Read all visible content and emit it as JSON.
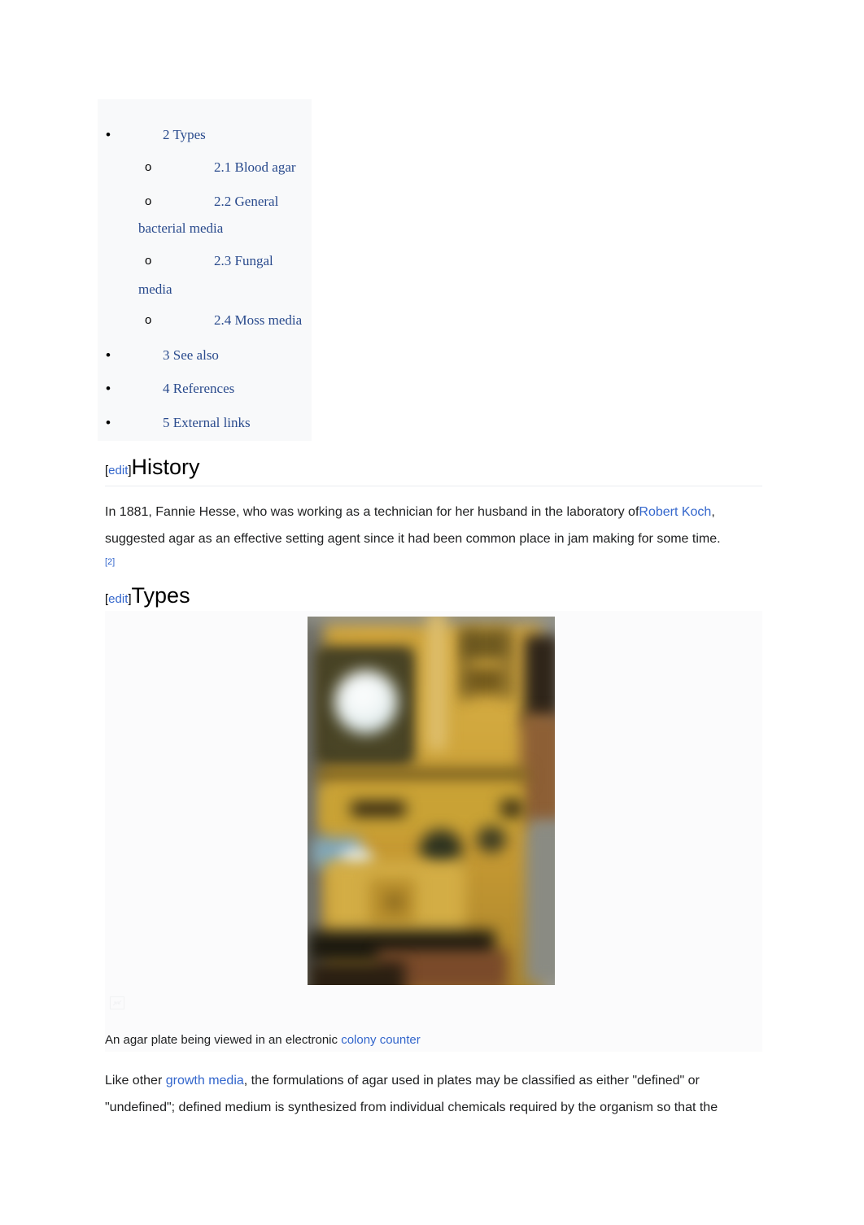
{
  "toc": {
    "items": [
      {
        "marker": "bullet",
        "number": "2",
        "label": "Types",
        "text": "2 Types",
        "level": 1
      },
      {
        "marker": "circle",
        "number": "2.1",
        "label": "Blood agar",
        "text": "2.1 Blood agar",
        "level": 2
      },
      {
        "marker": "circle",
        "number": "2.2",
        "label": "General bacterial media",
        "text": "2.2 General",
        "text2": "bacterial media",
        "level": 2
      },
      {
        "marker": "circle",
        "number": "2.3",
        "label": "Fungal media",
        "text": "2.3 Fungal",
        "text2": "media",
        "level": 2
      },
      {
        "marker": "circle",
        "number": "2.4",
        "label": "Moss media",
        "text": "2.4 Moss media",
        "level": 2
      },
      {
        "marker": "bullet",
        "number": "3",
        "label": "See also",
        "text": "3 See also",
        "level": 1
      },
      {
        "marker": "bullet",
        "number": "4",
        "label": "References",
        "text": "4 References",
        "level": 1
      },
      {
        "marker": "bullet",
        "number": "5",
        "label": "External links",
        "text": "5 External links",
        "level": 1
      }
    ],
    "bullet_glyph": "•",
    "circle_glyph": "o"
  },
  "sections": {
    "history": {
      "edit_open": "[",
      "edit_label": "edit",
      "edit_close": "]",
      "title": "History",
      "paragraph_line1_a": "In 1881, Fannie Hesse, who was working as a technician for her husband in the laboratory of",
      "paragraph_link": "Robert Koch",
      "paragraph_line1_b": ",",
      "paragraph_line2": "suggested agar as an effective setting agent since it had been common place in jam making for some time.",
      "reference": "[2]"
    },
    "types": {
      "edit_open": "[",
      "edit_label": "edit",
      "edit_close": "]",
      "title": "Types",
      "caption_a": "An agar plate being viewed in an electronic ",
      "caption_link": "colony counter",
      "paragraph_a": "Like other ",
      "paragraph_link": "growth media",
      "paragraph_b": ", the formulations of agar used in plates may be classified as either \"defined\" or \"undefined\"; defined medium is synthesized from individual chemicals required by the organism so that the"
    }
  },
  "colors": {
    "toc_link": "#2a4b8d",
    "body_link": "#3366cc",
    "text": "#202122",
    "toc_background": "#f8f9fa",
    "figure_background": "#fbfbfc",
    "rule": "#eaecf0"
  },
  "icons": {
    "enlarge": "enlarge-icon"
  }
}
